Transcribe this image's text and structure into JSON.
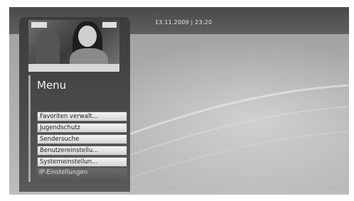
{
  "status_bar": {
    "datetime": "13.11.2009 | 23:20"
  },
  "menu": {
    "title": "Menu",
    "items": [
      {
        "label": "Favoriten verwalt..."
      },
      {
        "label": "Jugendschutz"
      },
      {
        "label": "Sendersuche"
      },
      {
        "label": "Benutzereinstellu..."
      },
      {
        "label": "Systemeinstellun..."
      },
      {
        "label": "IP-Einstellungen"
      }
    ]
  }
}
